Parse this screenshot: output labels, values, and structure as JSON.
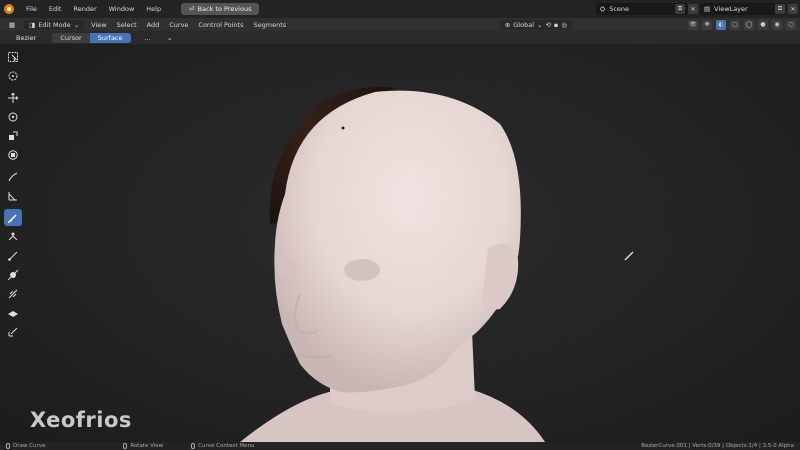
{
  "menu": {
    "items": [
      "File",
      "Edit",
      "Render",
      "Window",
      "Help"
    ],
    "back_button": "Back to Previous"
  },
  "scene": {
    "label": "Scene"
  },
  "view_layer": {
    "label": "ViewLayer"
  },
  "header": {
    "mode": "Edit Mode",
    "menus": [
      "View",
      "Select",
      "Add",
      "Curve",
      "Control Points",
      "Segments"
    ],
    "transform_orientation": "Global"
  },
  "tool_settings": {
    "type": "Bezier",
    "segments": [
      "Cursor",
      "Surface"
    ],
    "more": "..."
  },
  "toolbar": {
    "tools": [
      {
        "name": "select-box-tool",
        "icon": "select-box-icon"
      },
      {
        "name": "cursor-tool",
        "icon": "cursor-icon"
      },
      {
        "name": "move-tool",
        "icon": "move-icon"
      },
      {
        "name": "rotate-tool",
        "icon": "rotate-icon"
      },
      {
        "name": "scale-tool",
        "icon": "scale-icon"
      },
      {
        "name": "transform-tool",
        "icon": "transform-icon"
      },
      {
        "name": "annotate-tool",
        "icon": "annotate-icon"
      },
      {
        "name": "measure-tool",
        "icon": "measure-icon"
      },
      {
        "name": "draw-curve-tool",
        "icon": "draw-curve-icon",
        "active": true
      },
      {
        "name": "extrude-tool",
        "icon": "extrude-icon"
      },
      {
        "name": "radius-tool",
        "icon": "radius-icon"
      },
      {
        "name": "tilt-tool",
        "icon": "tilt-icon"
      },
      {
        "name": "randomize-tool",
        "icon": "randomize-icon"
      },
      {
        "name": "shrink-fatten-tool",
        "icon": "shrink-icon"
      },
      {
        "name": "curve-pen-tool",
        "icon": "pen-icon"
      }
    ]
  },
  "watermark": "Xeofrios",
  "status": {
    "left": "Draw Curve",
    "middle": "Rotate View",
    "right_menu": "Curve Context Menu",
    "stats": "BezierCurve.001 | Verts:0/39 | Objects:1/4 | 3.5.0 Alpha"
  },
  "colors": {
    "accent": "#4772b3",
    "skin": "#e6d6d4",
    "hair": "#2a1a14"
  }
}
